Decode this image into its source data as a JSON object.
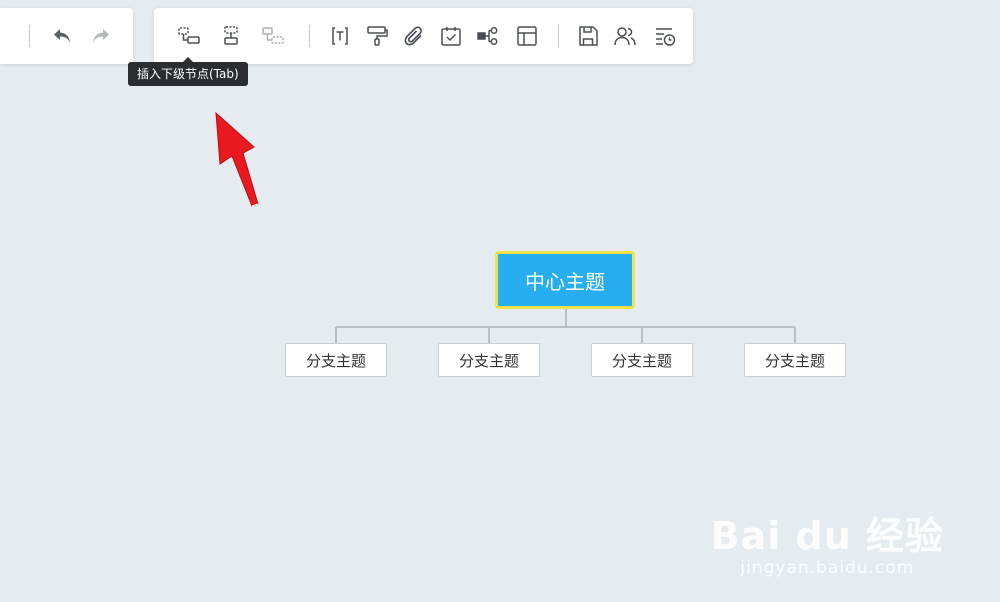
{
  "tooltip": {
    "text": "插入下级节点(Tab)"
  },
  "toolbar": {
    "left": [
      "undo-icon",
      "redo-icon"
    ],
    "main": [
      "insert-child-node-icon",
      "insert-sibling-node-icon",
      "insert-parent-node-icon",
      "text-format-icon",
      "format-painter-icon",
      "attachment-icon",
      "task-icon",
      "relationship-icon",
      "layout-icon",
      "save-icon",
      "collaborators-icon",
      "history-icon"
    ]
  },
  "mindmap": {
    "root": {
      "label": "中心主题"
    },
    "branches": [
      {
        "label": "分支主题"
      },
      {
        "label": "分支主题"
      },
      {
        "label": "分支主题"
      },
      {
        "label": "分支主题"
      }
    ]
  },
  "colors": {
    "canvas": "#e6ebef",
    "root_fill": "#27aef0",
    "root_border": "#f0e24a",
    "connector": "#b8bfc6",
    "annotation_arrow": "#e8191f"
  },
  "watermark": {
    "brand": "Bai du 经验",
    "site": "jingyan.baidu.com"
  }
}
